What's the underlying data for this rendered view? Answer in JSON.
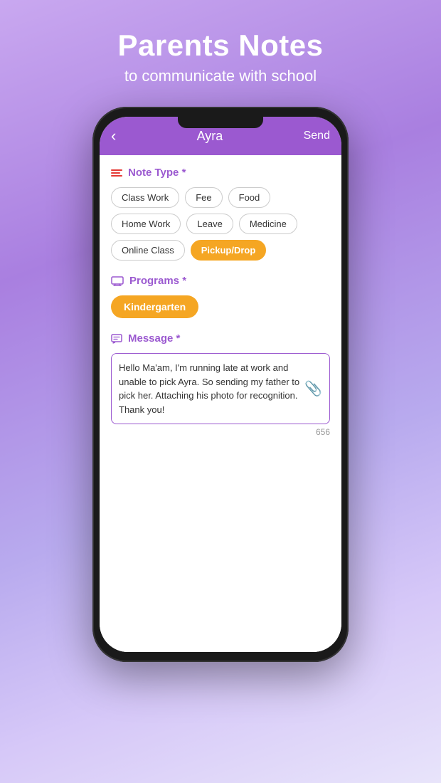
{
  "header": {
    "title": "Parents Notes",
    "subtitle": "to communicate with school"
  },
  "appBar": {
    "back": "‹",
    "screenTitle": "Ayra",
    "send": "Send"
  },
  "noteTypeSection": {
    "label": "Note Type *",
    "chips": [
      {
        "id": "class-work",
        "label": "Class Work",
        "active": false
      },
      {
        "id": "fee",
        "label": "Fee",
        "active": false
      },
      {
        "id": "food",
        "label": "Food",
        "active": false
      },
      {
        "id": "home-work",
        "label": "Home Work",
        "active": false
      },
      {
        "id": "leave",
        "label": "Leave",
        "active": false
      },
      {
        "id": "medicine",
        "label": "Medicine",
        "active": false
      },
      {
        "id": "online-class",
        "label": "Online Class",
        "active": false
      },
      {
        "id": "pickup-drop",
        "label": "Pickup/Drop",
        "active": true
      }
    ]
  },
  "programsSection": {
    "label": "Programs *",
    "selected": "Kindergarten"
  },
  "messageSection": {
    "label": "Message *",
    "text": "Hello Ma'am, I'm running late at work and unable to pick Ayra. So sending my father to pick her. Attaching his photo for recognition. Thank you!",
    "charCount": "656"
  }
}
